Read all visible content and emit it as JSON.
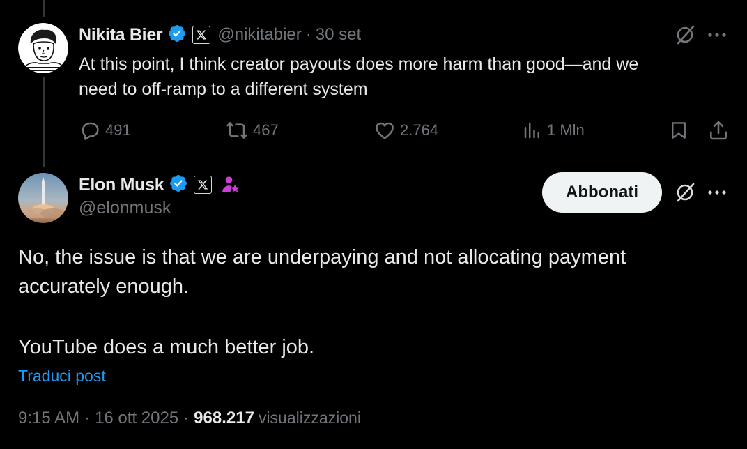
{
  "parent_post": {
    "author_name": "Nikita Bier",
    "handle": "@nikitabier",
    "separator": "·",
    "time_ago": "30 set",
    "text_line1": "At this point, I think creator payouts does more harm than good—and we",
    "text_line2": "need to off-ramp to a different system",
    "stats": {
      "replies": "491",
      "reposts": "467",
      "likes": "2.764",
      "views": "1 Mln"
    }
  },
  "main_post": {
    "author_name": "Elon Musk",
    "handle": "@elonmusk",
    "follow_label": "Abbonati",
    "text_line1": "No, the issue is that we are underpaying and not allocating payment",
    "text_line2": "accurately enough.",
    "text_line3": "YouTube does a much better job.",
    "translate_label": "Traduci post",
    "time": "9:15 AM",
    "separator": "·",
    "date": "16 ott 2025",
    "views_count": "968.217",
    "views_label": "visualizzazioni"
  },
  "colors": {
    "background": "#000000",
    "primary_text": "#e7e9ea",
    "secondary_text": "#71767b",
    "link": "#1d9bf0",
    "verified": "#1d9bf0",
    "affiliate_badge": "#c93fd8",
    "follow_button_bg": "#eff3f4"
  },
  "icons": {
    "verified": "verified-badge-icon",
    "affiliation": "x-logo-icon",
    "grok": "grok-icon",
    "more": "more-icon",
    "reply": "reply-icon",
    "repost": "repost-icon",
    "like": "heart-icon",
    "views": "analytics-icon",
    "bookmark": "bookmark-icon",
    "share": "share-icon",
    "subscriber_badge": "user-star-icon"
  }
}
